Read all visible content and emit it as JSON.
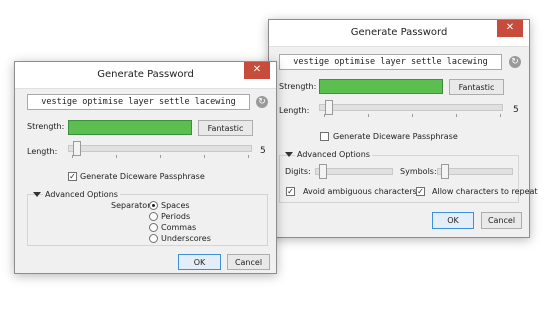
{
  "back": {
    "title": "Generate Password",
    "close_glyph": "✕",
    "password": "vestige optimise layer settle lacewing",
    "refresh_glyph": "↻",
    "strength_label": "Strength:",
    "strength_value": "Fantastic",
    "strength_color": "#5cbe4e",
    "length_label": "Length:",
    "length_value": "5",
    "length_fraction": 0.0,
    "diceware_label": "Generate Diceware Passphrase",
    "diceware_checked": false,
    "advanced_label": "Advanced Options",
    "digits_label": "Digits:",
    "digits_fraction": 0.0,
    "symbols_label": "Symbols:",
    "symbols_fraction": 0.0,
    "ambiguous_label": "Avoid ambiguous characters",
    "ambiguous_checked": true,
    "repeat_label": "Allow characters to repeat",
    "repeat_checked": true,
    "ok_label": "OK",
    "cancel_label": "Cancel"
  },
  "front": {
    "title": "Generate Password",
    "close_glyph": "✕",
    "password": "vestige optimise layer settle lacewing",
    "refresh_glyph": "↻",
    "strength_label": "Strength:",
    "strength_value": "Fantastic",
    "strength_color": "#5cbe4e",
    "length_label": "Length:",
    "length_value": "5",
    "length_fraction": 0.0,
    "diceware_label": "Generate Diceware Passphrase",
    "diceware_checked": true,
    "advanced_label": "Advanced Options",
    "separator_label": "Separator:",
    "separators": [
      {
        "label": "Spaces",
        "selected": true
      },
      {
        "label": "Periods",
        "selected": false
      },
      {
        "label": "Commas",
        "selected": false
      },
      {
        "label": "Underscores",
        "selected": false
      }
    ],
    "ok_label": "OK",
    "cancel_label": "Cancel"
  }
}
